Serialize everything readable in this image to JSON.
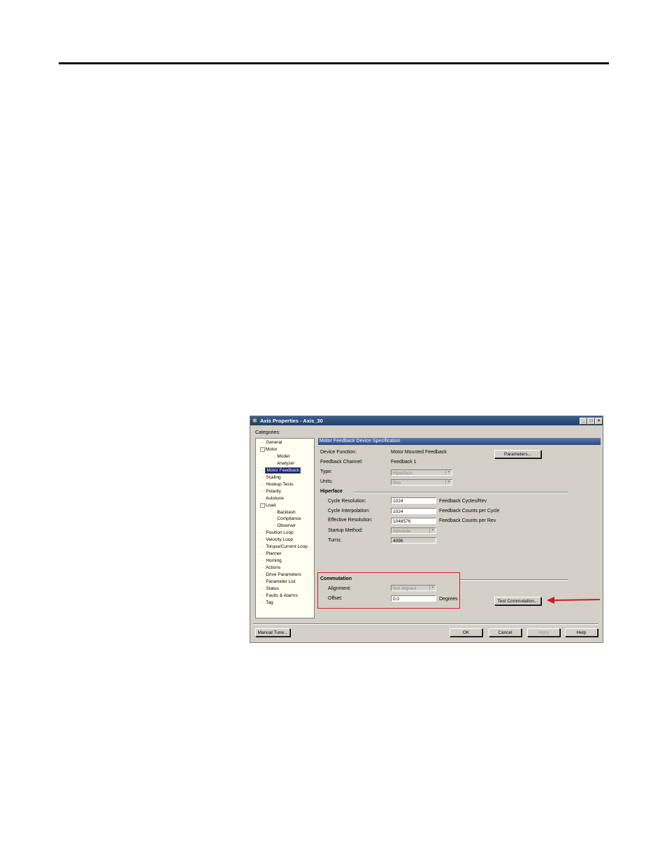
{
  "window": {
    "title": "Axis Properties - Axis_30"
  },
  "categories_label": "Categories:",
  "tree": [
    {
      "label": "General",
      "level": 1
    },
    {
      "label": "Motor",
      "level": 1,
      "expander": "−"
    },
    {
      "label": "Model",
      "level": 2
    },
    {
      "label": "Analyzer",
      "level": 2
    },
    {
      "label": "Motor Feedback",
      "level": 1,
      "selected": true
    },
    {
      "label": "Scaling",
      "level": 1
    },
    {
      "label": "Hookup Tests",
      "level": 1
    },
    {
      "label": "Polarity",
      "level": 1
    },
    {
      "label": "Autotune",
      "level": 1
    },
    {
      "label": "Load",
      "level": 1,
      "expander": "−"
    },
    {
      "label": "Backlash",
      "level": 2
    },
    {
      "label": "Compliance",
      "level": 2
    },
    {
      "label": "Observer",
      "level": 2
    },
    {
      "label": "Position Loop",
      "level": 1
    },
    {
      "label": "Velocity Loop",
      "level": 1
    },
    {
      "label": "Torque/Current Loop",
      "level": 1
    },
    {
      "label": "Planner",
      "level": 1
    },
    {
      "label": "Homing",
      "level": 1
    },
    {
      "label": "Actions",
      "level": 1
    },
    {
      "label": "Drive Parameters",
      "level": 1
    },
    {
      "label": "Parameter List",
      "level": 1
    },
    {
      "label": "Status",
      "level": 1
    },
    {
      "label": "Faults & Alarms",
      "level": 1
    },
    {
      "label": "Tag",
      "level": 1
    }
  ],
  "panel": {
    "header": "Motor Feedback Device Specification",
    "device_function_label": "Device Function:",
    "device_function_value": "Motor Mounted Feedback",
    "feedback_channel_label": "Feedback Channel:",
    "feedback_channel_value": "Feedback 1",
    "parameters_button": "Parameters...",
    "type_label": "Type:",
    "type_value": "Hiperface",
    "units_label": "Units:",
    "units_value": "Rev",
    "hiperface_section": "Hiperface",
    "cycle_resolution_label": "Cycle Resolution:",
    "cycle_resolution_value": "1024",
    "cycle_resolution_unit": "Feedback Cycles/Rev",
    "cycle_interpolation_label": "Cycle Interpolation:",
    "cycle_interpolation_value": "1024",
    "cycle_interpolation_unit": "Feedback Counts per Cycle",
    "effective_resolution_label": "Effective Resolution:",
    "effective_resolution_value": "1048576",
    "effective_resolution_unit": "Feedback Counts per Rev",
    "startup_method_label": "Startup Method:",
    "startup_method_value": "Absolute",
    "turns_label": "Turns:",
    "turns_value": "4096",
    "commutation_section": "Commutation",
    "alignment_label": "Alignment:",
    "alignment_value": "Not Aligned",
    "offset_label": "Offset:",
    "offset_value": "0.0",
    "offset_unit": "Degrees",
    "test_commutation_button": "Test Commutation..."
  },
  "footer": {
    "manual_tune": "Manual Tune...",
    "ok": "OK",
    "cancel": "Cancel",
    "apply": "Apply",
    "help": "Help"
  },
  "colors": {
    "highlight": "#d02030",
    "titlebar": "#2c4a80"
  }
}
